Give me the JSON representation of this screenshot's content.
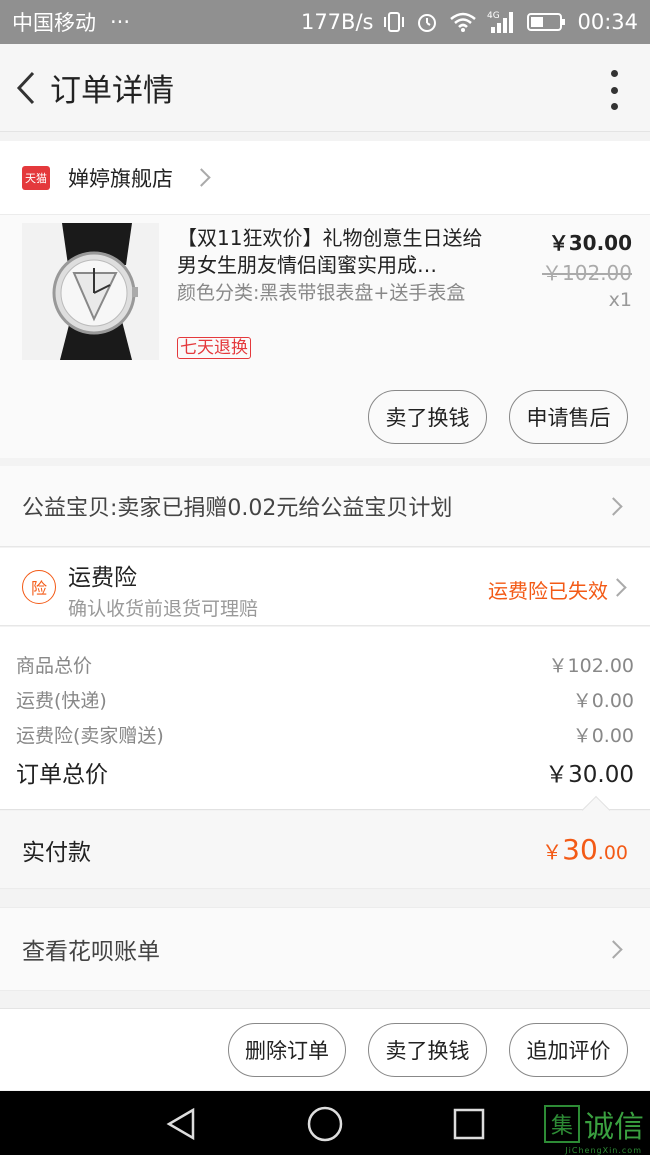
{
  "status_bar": {
    "carrier": "中国移动",
    "dots": "···",
    "net_speed": "177B/s",
    "network_type": "4G",
    "time": "00:34"
  },
  "header": {
    "title": "订单详情"
  },
  "shop": {
    "badge": "天猫",
    "name": "婵婷旗舰店"
  },
  "product": {
    "title": "【双11狂欢价】礼物创意生日送给男女生朋友情侣闺蜜实用成…",
    "spec": "颜色分类:黑表带银表盘+送手表盒",
    "tag": "七天退换",
    "price": "￥30.00",
    "original_price": "￥102.00",
    "quantity": "x1",
    "buttons": {
      "sell": "卖了换钱",
      "after_sale": "申请售后"
    }
  },
  "charity": {
    "text": "公益宝贝:卖家已捐赠0.02元给公益宝贝计划"
  },
  "insurance": {
    "icon_text": "险",
    "title": "运费险",
    "subtitle": "确认收货前退货可理赔",
    "status": "运费险已失效"
  },
  "summary": {
    "rows": [
      {
        "label": "商品总价",
        "value": "￥102.00"
      },
      {
        "label": "运费(快递)",
        "value": "￥0.00"
      },
      {
        "label": "运费险(卖家赠送)",
        "value": "￥0.00"
      }
    ],
    "total_label": "订单总价",
    "total_value": "￥30.00"
  },
  "paid": {
    "label": "实付款",
    "currency": "￥",
    "integer": "30",
    "decimal": ".00"
  },
  "huabei": {
    "text": "查看花呗账单"
  },
  "actions": {
    "delete": "删除订单",
    "sell": "卖了换钱",
    "review": "追加评价"
  },
  "watermark": {
    "box": "集",
    "text": "诚信",
    "sub": "JiChengXin.com"
  },
  "colors": {
    "accent": "#f35a16",
    "tmall_red": "#e4393c"
  }
}
